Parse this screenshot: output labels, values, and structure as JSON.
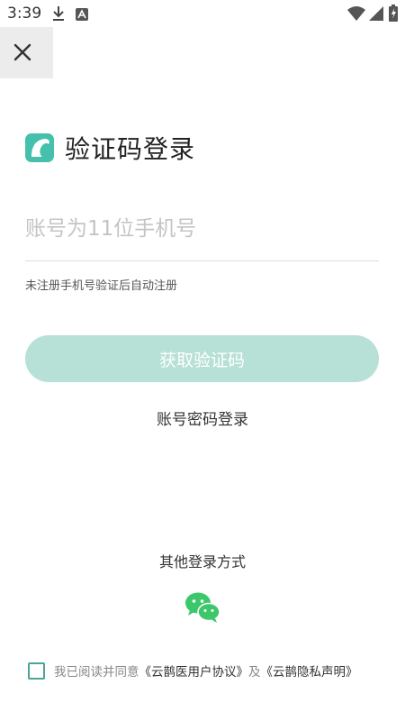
{
  "status_bar": {
    "time": "3:39",
    "left_icons": [
      "download-icon",
      "a-notification-icon"
    ],
    "right_icons": [
      "wifi-icon",
      "signal-icon",
      "battery-charging-icon"
    ]
  },
  "nav": {
    "close_icon": "close-icon"
  },
  "login": {
    "logo_icon": "yunque-logo-icon",
    "title": "验证码登录",
    "phone_placeholder": "账号为11位手机号",
    "phone_value": "",
    "hint": "未注册手机号验证后自动注册",
    "get_code_label": "获取验证码",
    "password_login_label": "账号密码登录"
  },
  "other_login": {
    "label": "其他登录方式",
    "wechat_icon": "wechat-icon"
  },
  "agreement": {
    "checked": false,
    "prefix": "我已阅读并同意",
    "user_agreement": "《云鹊医用户协议》",
    "connector": "及",
    "privacy_statement": "《云鹊隐私声明》"
  },
  "colors": {
    "accent": "#45c0ac",
    "button_disabled": "#b7e0d6",
    "checkbox_border": "#4aa594",
    "wechat_green": "#3cc76b"
  }
}
